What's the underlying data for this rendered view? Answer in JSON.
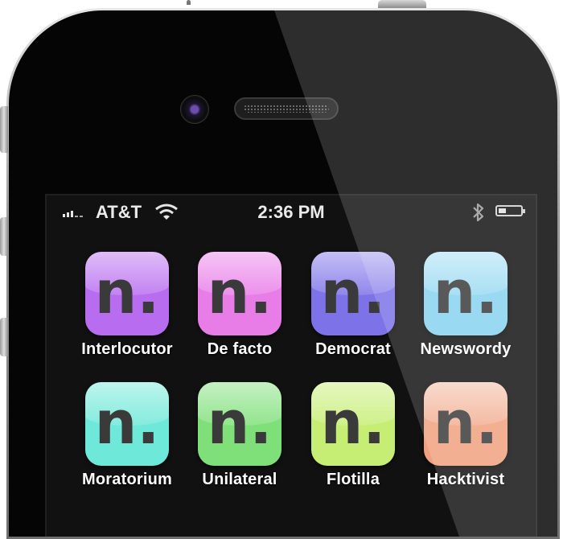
{
  "status_bar": {
    "signal_icon": "cell-signal-icon",
    "carrier": "AT&T",
    "wifi_icon": "wifi-icon",
    "time": "2:36 PM",
    "bluetooth_icon": "bluetooth-icon",
    "battery_icon": "battery-icon",
    "battery_level": 0.35
  },
  "apps": [
    {
      "label": "Interlocutor",
      "glyph": "n.",
      "color": "#b86cf0"
    },
    {
      "label": "De facto",
      "glyph": "n.",
      "color": "#e97de8"
    },
    {
      "label": "Democrat",
      "glyph": "n.",
      "color": "#7d72e8"
    },
    {
      "label": "Newswordy",
      "glyph": "n.",
      "color": "#86d3f0"
    },
    {
      "label": "Moratorium",
      "glyph": "n.",
      "color": "#6ee8d8"
    },
    {
      "label": "Unilateral",
      "glyph": "n.",
      "color": "#7fe07a"
    },
    {
      "label": "Flotilla",
      "glyph": "n.",
      "color": "#c6ee74"
    },
    {
      "label": "Hacktivist",
      "glyph": "n.",
      "color": "#f0a07e"
    }
  ]
}
